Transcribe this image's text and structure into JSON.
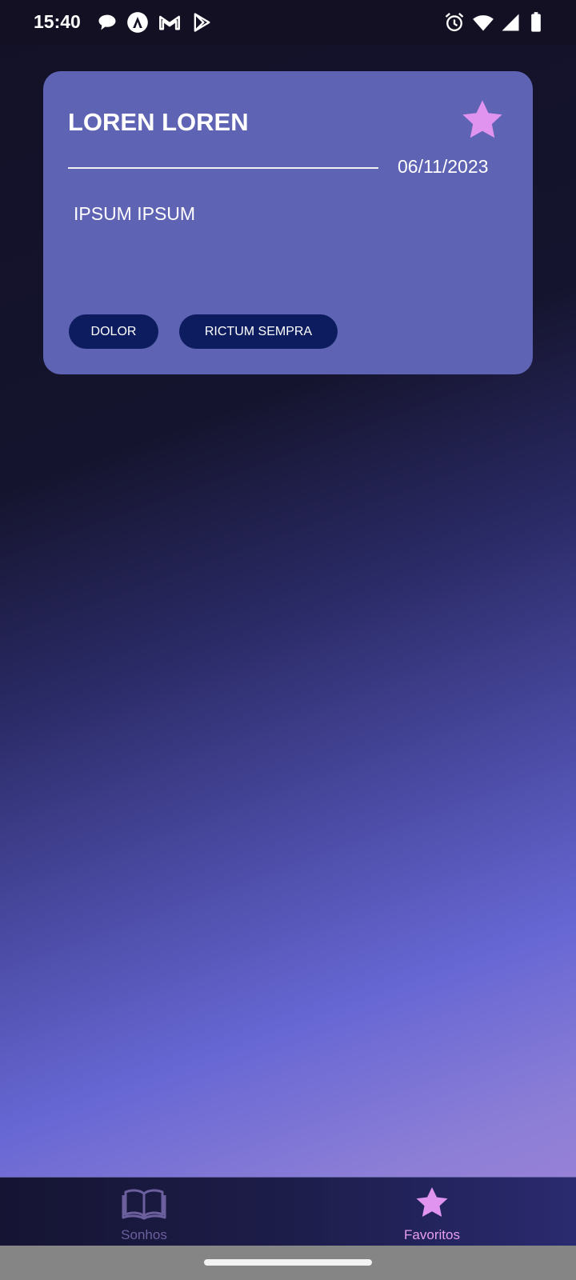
{
  "status_bar": {
    "time": "15:40",
    "left_icons": [
      "chat-bubble-icon",
      "app-a-icon",
      "gmail-icon",
      "play-store-icon"
    ],
    "right_icons": [
      "alarm-icon",
      "wifi-icon",
      "signal-icon",
      "battery-icon"
    ]
  },
  "card": {
    "title": "LOREN LOREN",
    "date": "06/11/2023",
    "body": "IPSUM IPSUM",
    "favorite": true,
    "tags": [
      "DOLOR",
      "RICTUM SEMPRA"
    ]
  },
  "bottom_nav": {
    "items": [
      {
        "label": "Sonhos",
        "icon": "open-book-icon",
        "active": false
      },
      {
        "label": "Favoritos",
        "icon": "star-icon",
        "active": true
      }
    ]
  },
  "colors": {
    "card_bg": "#5f63b3",
    "tag_bg": "#0d1c5f",
    "accent_star": "#e193f0",
    "nav_inactive": "#6b5f9e",
    "nav_active": "#e89df2"
  }
}
